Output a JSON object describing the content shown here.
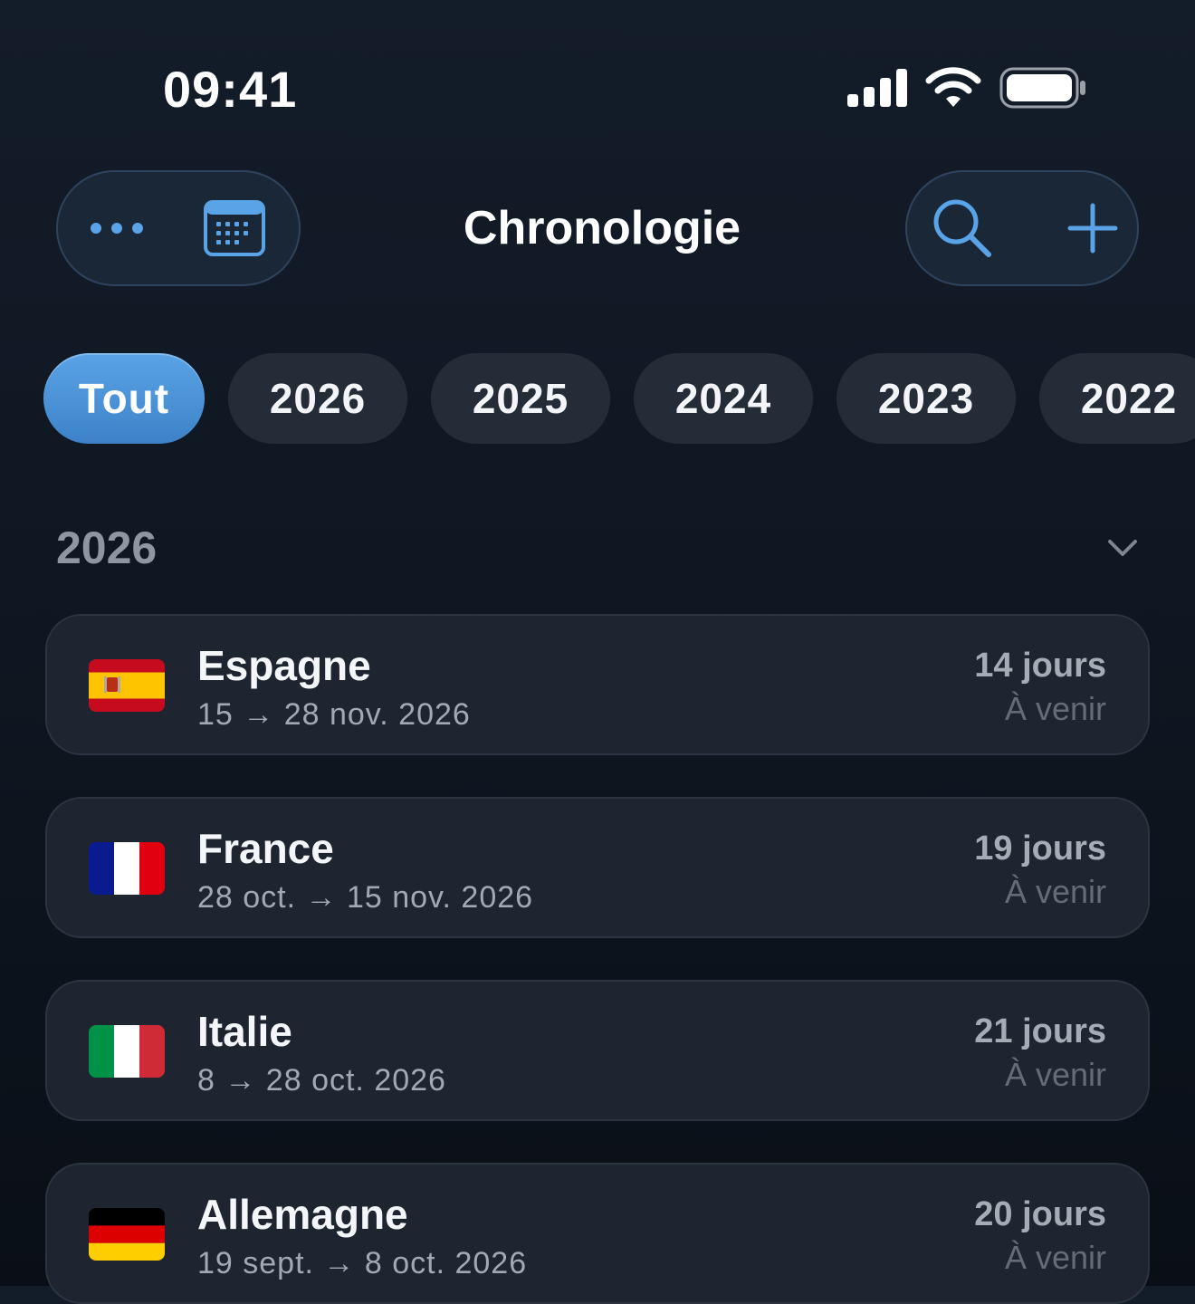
{
  "status_bar": {
    "time": "09:41",
    "icons": [
      "cellular-signal-icon",
      "wifi-icon",
      "battery-icon"
    ]
  },
  "nav": {
    "title": "Chronologie",
    "left_buttons": [
      "more-icon",
      "calendar-icon"
    ],
    "right_buttons": [
      "search-icon",
      "plus-icon"
    ]
  },
  "filters": {
    "chips": [
      {
        "label": "Tout",
        "active": true
      },
      {
        "label": "2026",
        "active": false
      },
      {
        "label": "2025",
        "active": false
      },
      {
        "label": "2024",
        "active": false
      },
      {
        "label": "2023",
        "active": false
      },
      {
        "label": "2022",
        "active": false
      }
    ]
  },
  "section": {
    "title": "2026",
    "icon": "chevron-down-icon"
  },
  "trips": [
    {
      "country": "Espagne",
      "dates": "15 → 28 nov. 2026",
      "days": "14 jours",
      "status": "À venir",
      "flag": "spain-flag-icon"
    },
    {
      "country": "France",
      "dates": "28 oct. → 15 nov. 2026",
      "days": "19 jours",
      "status": "À venir",
      "flag": "france-flag-icon"
    },
    {
      "country": "Italie",
      "dates": "8 → 28 oct. 2026",
      "days": "21 jours",
      "status": "À venir",
      "flag": "italy-flag-icon"
    },
    {
      "country": "Allemagne",
      "dates": "19 sept. → 8 oct. 2026",
      "days": "20 jours",
      "status": "À venir",
      "flag": "germany-flag-icon"
    }
  ],
  "colors": {
    "accent": "#4a90d9",
    "background": "#0f1722",
    "card": "#1f2530",
    "chip": "#242c37"
  }
}
